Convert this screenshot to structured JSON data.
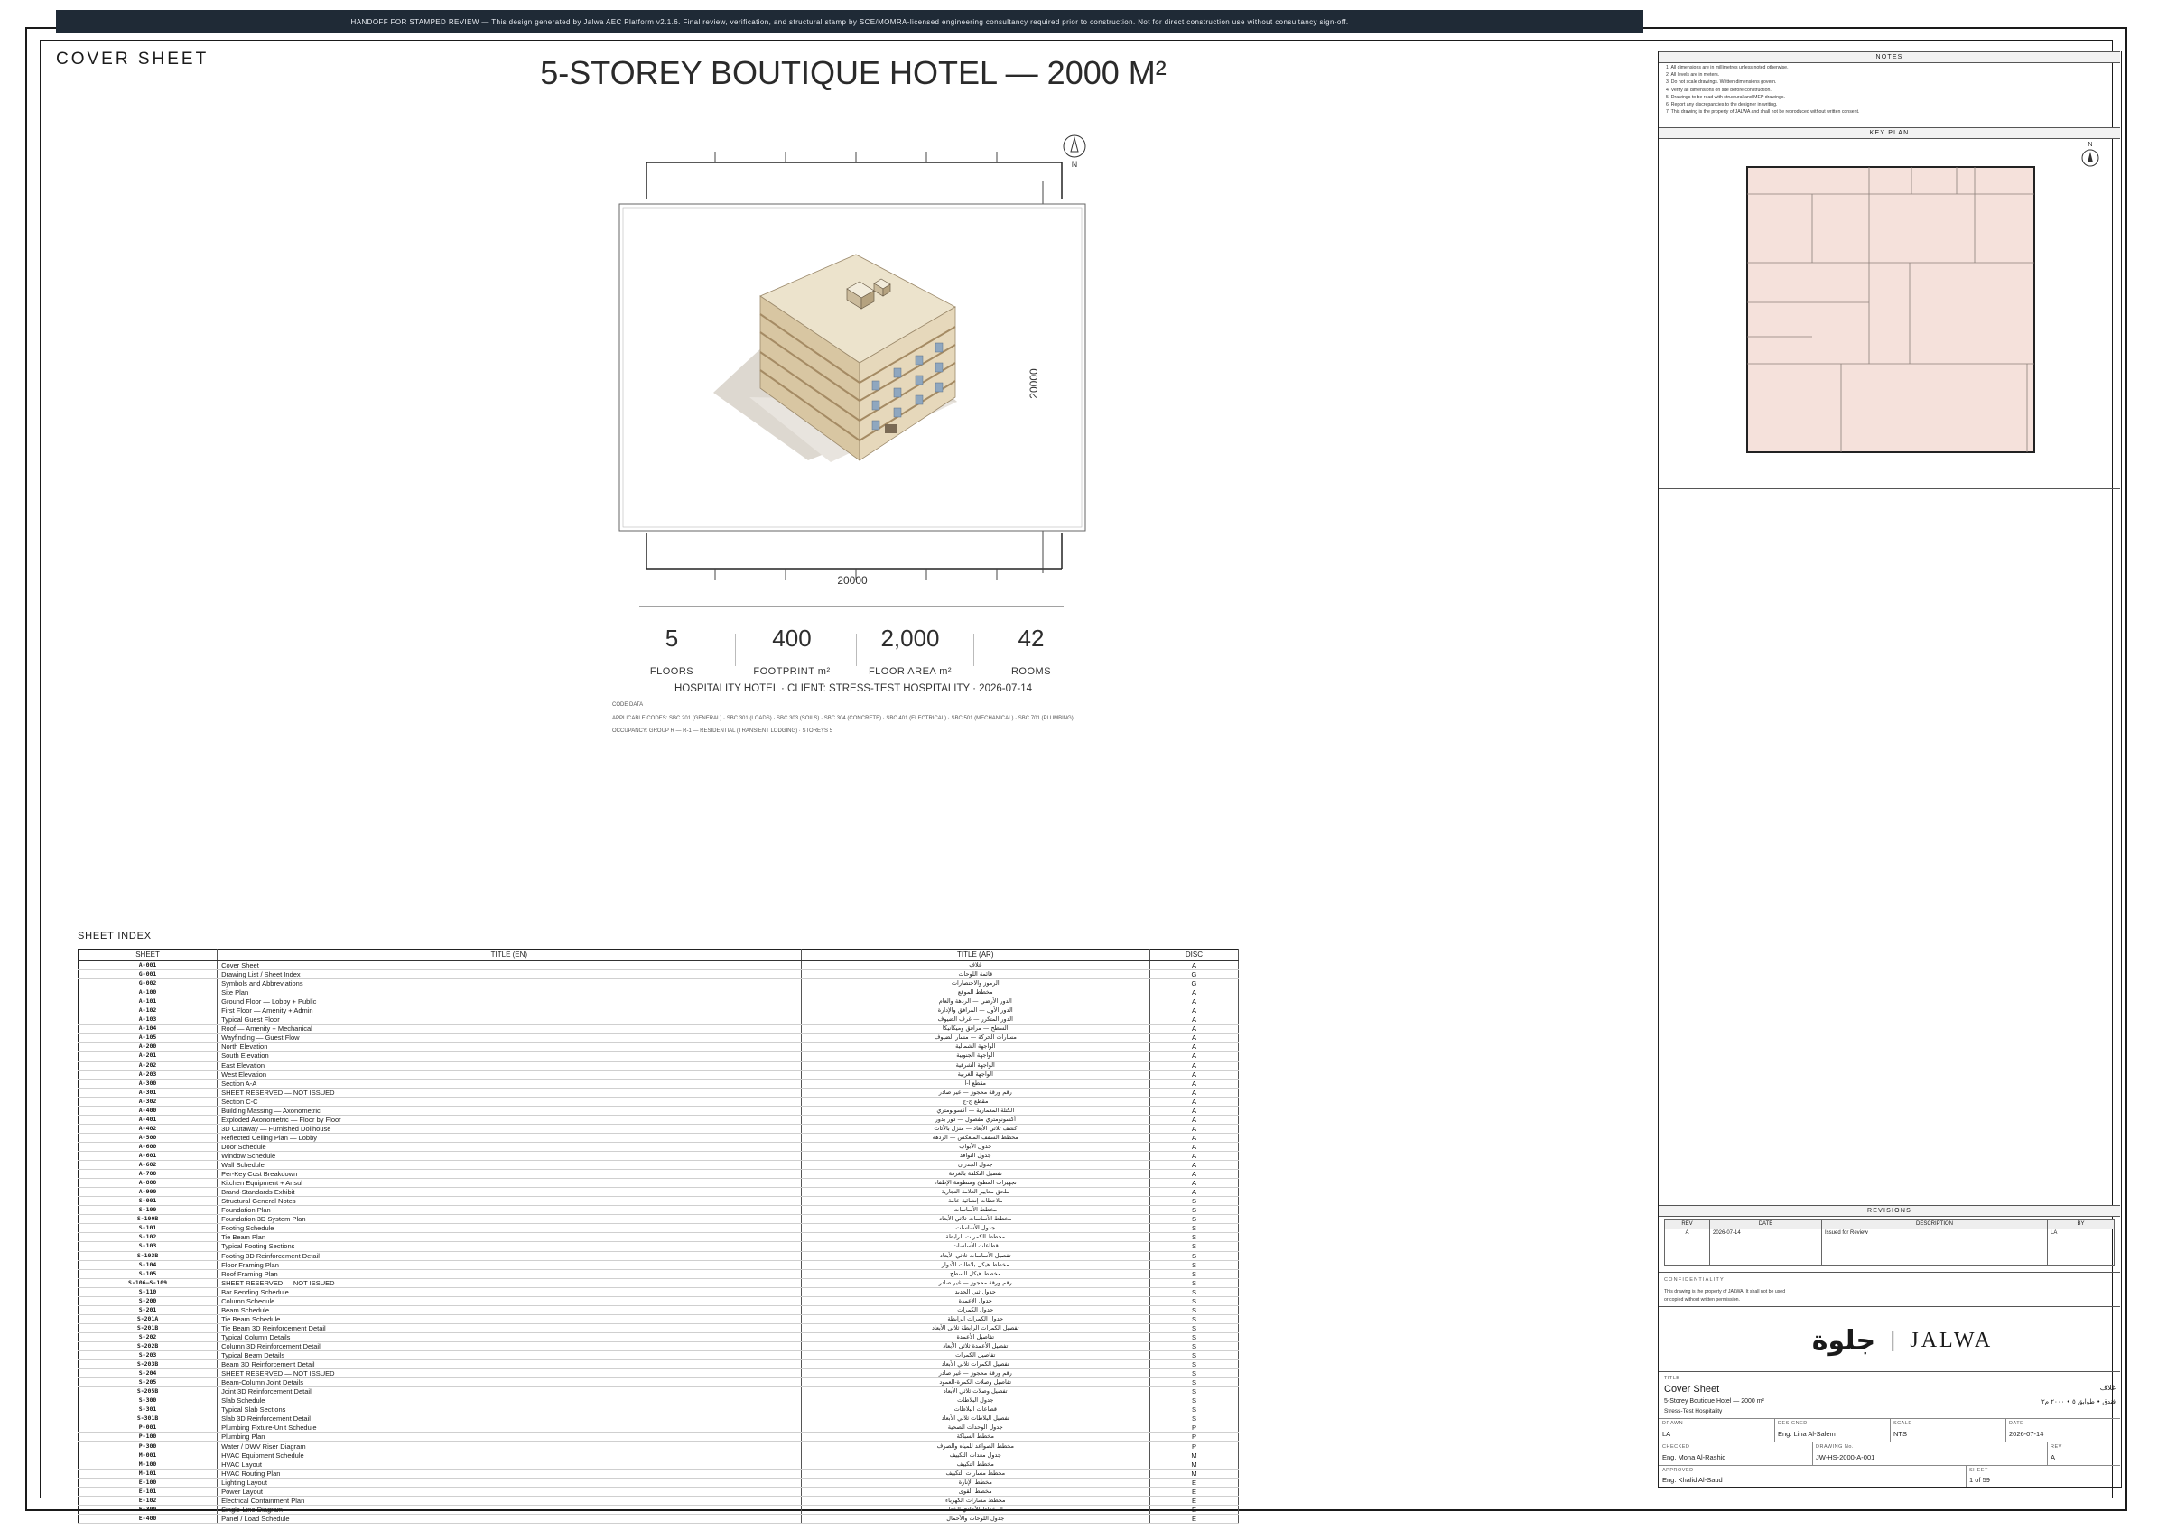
{
  "banner": "HANDOFF FOR STAMPED REVIEW — This design generated by Jalwa AEC Platform v2.1.6. Final review, verification, and structural stamp by SCE/MOMRA-licensed engineering consultancy required prior to construction. Not for direct construction use without consultancy sign-off.",
  "sheet_label": "COVER SHEET",
  "project_title": "5-STOREY BOUTIQUE HOTEL — 2000 M²",
  "drawing": {
    "north_label": "N",
    "dim_height": "20000",
    "dim_width": "20000"
  },
  "stats": [
    {
      "value": "5",
      "label": "FLOORS"
    },
    {
      "value": "400",
      "label": "FOOTPRINT m²"
    },
    {
      "value": "2,000",
      "label": "FLOOR AREA m²"
    },
    {
      "value": "42",
      "label": "ROOMS"
    }
  ],
  "subline": "HOSPITALITY HOTEL · CLIENT: STRESS-TEST HOSPITALITY · 2026-07-14",
  "code_data": {
    "heading": "CODE DATA",
    "line1": "APPLICABLE CODES: SBC 201 (GENERAL) · SBC 301 (LOADS) · SBC 303 (SOILS) · SBC 304 (CONCRETE) · SBC 401 (ELECTRICAL) · SBC 501 (MECHANICAL) · SBC 701 (PLUMBING)",
    "line2": "OCCUPANCY: GROUP R — R-1 — RESIDENTIAL (TRANSIENT LODGING) · STOREYS 5"
  },
  "sheet_index": {
    "label": "SHEET INDEX",
    "headers": [
      "SHEET",
      "TITLE (EN)",
      "TITLE (AR)",
      "DISC"
    ],
    "rows": [
      [
        "A-001",
        "Cover Sheet",
        "غلاف",
        "A"
      ],
      [
        "G-001",
        "Drawing List / Sheet Index",
        "قائمة اللوحات",
        "G"
      ],
      [
        "G-002",
        "Symbols and Abbreviations",
        "الرموز والاختصارات",
        "G"
      ],
      [
        "A-100",
        "Site Plan",
        "مخطط الموقع",
        "A"
      ],
      [
        "A-101",
        "Ground Floor — Lobby + Public",
        "الدور الأرضي — الردهة والعام",
        "A"
      ],
      [
        "A-102",
        "First Floor — Amenity + Admin",
        "الدور الأول — المرافق والإدارة",
        "A"
      ],
      [
        "A-103",
        "Typical Guest Floor",
        "الدور المتكرر — غرف الضيوف",
        "A"
      ],
      [
        "A-104",
        "Roof — Amenity + Mechanical",
        "السطح — مرافق وميكانيكا",
        "A"
      ],
      [
        "A-105",
        "Wayfinding — Guest Flow",
        "مسارات الحركة — مسار الضيوف",
        "A"
      ],
      [
        "A-200",
        "North Elevation",
        "الواجهة الشمالية",
        "A"
      ],
      [
        "A-201",
        "South Elevation",
        "الواجهة الجنوبية",
        "A"
      ],
      [
        "A-202",
        "East Elevation",
        "الواجهة الشرقية",
        "A"
      ],
      [
        "A-203",
        "West Elevation",
        "الواجهة الغربية",
        "A"
      ],
      [
        "A-300",
        "Section A-A",
        "مقطع أ-أ",
        "A"
      ],
      [
        "A-301",
        "SHEET RESERVED — NOT ISSUED",
        "رقم ورقة محجوز — غير صادر",
        "A"
      ],
      [
        "A-302",
        "Section C-C",
        "مقطع ج-ج",
        "A"
      ],
      [
        "A-400",
        "Building Massing — Axonometric",
        "الكتلة المعمارية — أكسونومتري",
        "A"
      ],
      [
        "A-401",
        "Exploded Axonometric — Floor by Floor",
        "أكسونومتري مفصول — دور بدور",
        "A"
      ],
      [
        "A-402",
        "3D Cutaway — Furnished Dollhouse",
        "كشف ثلاثي الأبعاد — منزل بالأثاث",
        "A"
      ],
      [
        "A-500",
        "Reflected Ceiling Plan — Lobby",
        "مخطط السقف المنعكس — الردهة",
        "A"
      ],
      [
        "A-600",
        "Door Schedule",
        "جدول الأبواب",
        "A"
      ],
      [
        "A-601",
        "Window Schedule",
        "جدول النوافذ",
        "A"
      ],
      [
        "A-602",
        "Wall Schedule",
        "جدول الجدران",
        "A"
      ],
      [
        "A-700",
        "Per-Key Cost Breakdown",
        "تفصيل التكلفة بالغرفة",
        "A"
      ],
      [
        "A-800",
        "Kitchen Equipment + Ansul",
        "تجهيزات المطبخ ومنظومة الإطفاء",
        "A"
      ],
      [
        "A-900",
        "Brand-Standards Exhibit",
        "ملحق معايير العلامة التجارية",
        "A"
      ],
      [
        "S-001",
        "Structural General Notes",
        "ملاحظات إنشائية عامة",
        "S"
      ],
      [
        "S-100",
        "Foundation Plan",
        "مخطط الأساسات",
        "S"
      ],
      [
        "S-100B",
        "Foundation 3D System Plan",
        "مخطط الأساسات ثلاثي الأبعاد",
        "S"
      ],
      [
        "S-101",
        "Footing Schedule",
        "جدول الأساسات",
        "S"
      ],
      [
        "S-102",
        "Tie Beam Plan",
        "مخطط الكمرات الرابطة",
        "S"
      ],
      [
        "S-103",
        "Typical Footing Sections",
        "قطاعات الأساسات",
        "S"
      ],
      [
        "S-103B",
        "Footing 3D Reinforcement Detail",
        "تفصيل الأساسات ثلاثي الأبعاد",
        "S"
      ],
      [
        "S-104",
        "Floor Framing Plan",
        "مخطط هيكل بلاطات الأدوار",
        "S"
      ],
      [
        "S-105",
        "Roof Framing Plan",
        "مخطط هيكل السطح",
        "S"
      ],
      [
        "S-106–S-109",
        "SHEET RESERVED — NOT ISSUED",
        "رقم ورقة محجوز — غير صادر",
        "S"
      ],
      [
        "S-110",
        "Bar Bending Schedule",
        "جدول ثني الحديد",
        "S"
      ],
      [
        "S-200",
        "Column Schedule",
        "جدول الأعمدة",
        "S"
      ],
      [
        "S-201",
        "Beam Schedule",
        "جدول الكمرات",
        "S"
      ],
      [
        "S-201A",
        "Tie Beam Schedule",
        "جدول الكمرات الرابطة",
        "S"
      ],
      [
        "S-201B",
        "Tie Beam 3D Reinforcement Detail",
        "تفصيل الكمرات الرابطة ثلاثي الأبعاد",
        "S"
      ],
      [
        "S-202",
        "Typical Column Details",
        "تفاصيل الأعمدة",
        "S"
      ],
      [
        "S-202B",
        "Column 3D Reinforcement Detail",
        "تفصيل الأعمدة ثلاثي الأبعاد",
        "S"
      ],
      [
        "S-203",
        "Typical Beam Details",
        "تفاصيل الكمرات",
        "S"
      ],
      [
        "S-203B",
        "Beam 3D Reinforcement Detail",
        "تفصيل الكمرات ثلاثي الأبعاد",
        "S"
      ],
      [
        "S-204",
        "SHEET RESERVED — NOT ISSUED",
        "رقم ورقة محجوز — غير صادر",
        "S"
      ],
      [
        "S-205",
        "Beam-Column Joint Details",
        "تفاصيل وصلات الكمرة-العمود",
        "S"
      ],
      [
        "S-205B",
        "Joint 3D Reinforcement Detail",
        "تفصيل وصلات ثلاثي الأبعاد",
        "S"
      ],
      [
        "S-300",
        "Slab Schedule",
        "جدول البلاطات",
        "S"
      ],
      [
        "S-301",
        "Typical Slab Sections",
        "قطاعات البلاطات",
        "S"
      ],
      [
        "S-301B",
        "Slab 3D Reinforcement Detail",
        "تفصيل البلاطات ثلاثي الأبعاد",
        "S"
      ],
      [
        "P-001",
        "Plumbing Fixture-Unit Schedule",
        "جدول الوحدات الصحية",
        "P"
      ],
      [
        "P-100",
        "Plumbing Plan",
        "مخطط السباكة",
        "P"
      ],
      [
        "P-300",
        "Water / DWV Riser Diagram",
        "مخطط الصواعد للمياه والصرف",
        "P"
      ],
      [
        "M-001",
        "HVAC Equipment Schedule",
        "جدول معدات التكييف",
        "M"
      ],
      [
        "M-100",
        "HVAC Layout",
        "مخطط التكييف",
        "M"
      ],
      [
        "M-101",
        "HVAC Routing Plan",
        "مخطط مسارات التكييف",
        "M"
      ],
      [
        "E-100",
        "Lighting Layout",
        "مخطط الإنارة",
        "E"
      ],
      [
        "E-101",
        "Power Layout",
        "مخطط القوى",
        "E"
      ],
      [
        "E-102",
        "Electrical Containment Plan",
        "مخطط مسارات الكهرباء",
        "E"
      ],
      [
        "E-300",
        "Single-Line Diagram",
        "المخطط الأحادي الخط",
        "E"
      ],
      [
        "E-400",
        "Panel / Load Schedule",
        "جدول اللوحات والأحمال",
        "E"
      ]
    ]
  },
  "notes": {
    "heading": "NOTES",
    "items": [
      "1. All dimensions are in millimetres unless noted otherwise.",
      "2. All levels are in meters.",
      "3. Do not scale drawings. Written dimensions govern.",
      "4. Verify all dimensions on site before construction.",
      "5. Drawings to be read with structural and MEP drawings.",
      "6. Report any discrepancies to the designer in writing.",
      "7. This drawing is the property of JALWA and shall not be reproduced without written consent."
    ]
  },
  "key_plan": {
    "heading": "KEY PLAN",
    "north_label": "N"
  },
  "revisions": {
    "heading": "REVISIONS",
    "headers": [
      "REV",
      "DATE",
      "DESCRIPTION",
      "BY"
    ],
    "rows": [
      [
        "A",
        "2026-07-14",
        "Issued for Review",
        "LA"
      ]
    ]
  },
  "confidentiality": {
    "heading": "CONFIDENTIALITY",
    "line1": "This drawing is the property of JALWA. It shall not be used",
    "line2": "or copied without written permission."
  },
  "logo": {
    "arabic": "جلوة",
    "latin": "JALWA",
    "sep": "|"
  },
  "title_block": {
    "title_label": "TITLE",
    "title_en": "Cover Sheet",
    "title_ar": "غلاف",
    "subtitle_en": "5-Storey Boutique Hotel — 2000 m²",
    "subtitle_ar": "فندق • طوابق ٥ • ٢٠٠٠ م٢",
    "client": "Stress-Test Hospitality",
    "drawn_label": "DRAWN",
    "drawn": "LA",
    "designed_label": "DESIGNED",
    "designed": "Eng. Lina Al-Salem",
    "scale_label": "SCALE",
    "scale": "NTS",
    "date_label": "DATE",
    "date": "2026-07-14",
    "checked_label": "CHECKED",
    "checked": "Eng. Mona Al-Rashid",
    "drawing_no_label": "DRAWING No.",
    "drawing_no": "JW-HS-2000-A-001",
    "rev_label": "REV",
    "rev": "A",
    "approved_label": "APPROVED",
    "approved": "Eng. Khalid Al-Saud",
    "sheet_label": "SHEET",
    "sheet": "1 of 59"
  },
  "colors": {
    "banner_bg": "#1f2a36",
    "building_light": "#ece3cc",
    "building_mid": "#d8c6a2",
    "building_dark": "#b89e74",
    "keyplan_fill": "#f5e1db"
  }
}
